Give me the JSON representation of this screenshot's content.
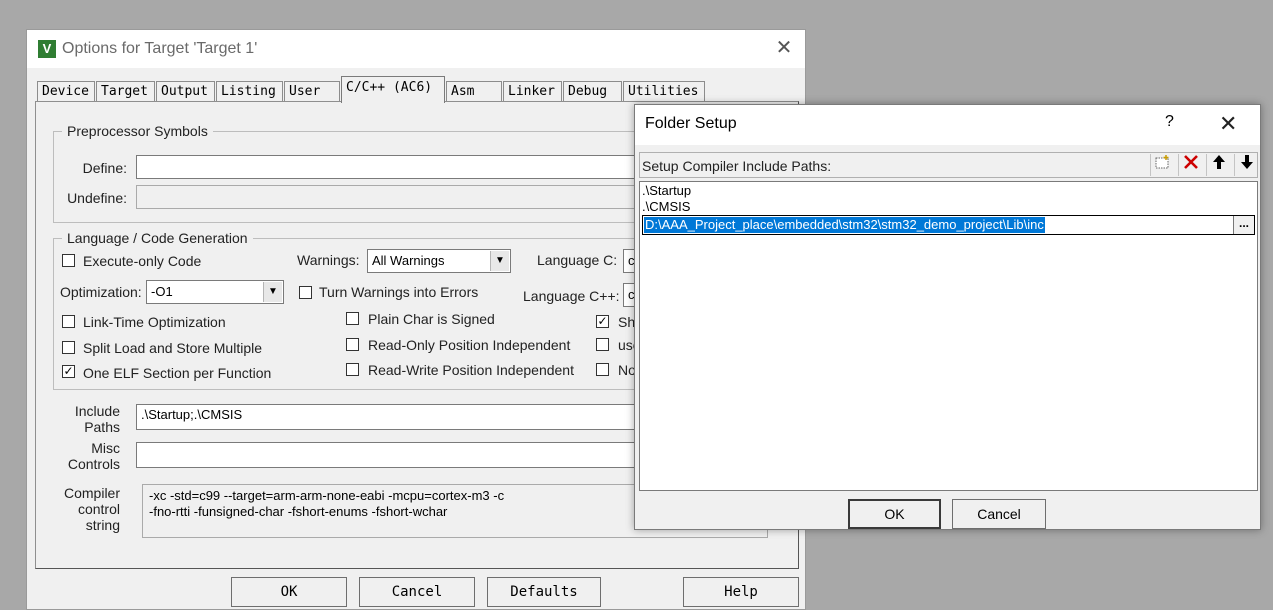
{
  "main_dialog": {
    "title": "Options for Target 'Target 1'",
    "app_icon_letter": "V",
    "close_glyph": "✕",
    "tabs": [
      {
        "label": "Device"
      },
      {
        "label": "Target"
      },
      {
        "label": "Output"
      },
      {
        "label": "Listing"
      },
      {
        "label": "User"
      },
      {
        "label": "C/C++ (AC6)"
      },
      {
        "label": "Asm"
      },
      {
        "label": "Linker"
      },
      {
        "label": "Debug"
      },
      {
        "label": "Utilities"
      }
    ],
    "preprocessor": {
      "legend": "Preprocessor Symbols",
      "define_label": "Define:",
      "define_value": "",
      "undefine_label": "Undefine:",
      "undefine_value": ""
    },
    "codegen": {
      "legend": "Language / Code Generation",
      "execute_only": {
        "label": "Execute-only Code",
        "checked": ""
      },
      "warnings_label": "Warnings:",
      "warnings_value": "All Warnings",
      "language_c_label": "Language C:",
      "language_c_value": "c",
      "optimization_label": "Optimization:",
      "optimization_value": "-O1",
      "turn_warnings": {
        "label": "Turn Warnings into Errors",
        "checked": ""
      },
      "language_cpp_label": "Language C++:",
      "language_cpp_value": "c",
      "lto": {
        "label": "Link-Time Optimization",
        "checked": ""
      },
      "plain_char": {
        "label": "Plain Char is Signed",
        "checked": ""
      },
      "short_opt": {
        "label": "Sh",
        "checked": "✓"
      },
      "split_load": {
        "label": "Split Load and Store Multiple",
        "checked": ""
      },
      "ropi": {
        "label": "Read-Only Position Independent",
        "checked": ""
      },
      "use_opt": {
        "label": "use",
        "checked": ""
      },
      "one_elf": {
        "label": "One ELF Section per Function",
        "checked": "✓"
      },
      "rwpi": {
        "label": "Read-Write Position Independent",
        "checked": ""
      },
      "no_opt": {
        "label": "No",
        "checked": ""
      }
    },
    "include_paths": {
      "label_line1": "Include",
      "label_line2": "Paths",
      "value": ".\\Startup;.\\CMSIS"
    },
    "misc_controls": {
      "label_line1": "Misc",
      "label_line2": "Controls",
      "value": ""
    },
    "compiler_control": {
      "label_line1": "Compiler",
      "label_line2": "control",
      "label_line3": "string",
      "line1": "-xc -std=c99 --target=arm-arm-none-eabi -mcpu=cortex-m3 -c",
      "line2": "-fno-rtti -funsigned-char -fshort-enums -fshort-wchar"
    },
    "buttons": {
      "ok": "OK",
      "cancel": "Cancel",
      "defaults": "Defaults",
      "help": "Help"
    }
  },
  "folder_dialog": {
    "title": "Folder Setup",
    "help_glyph": "?",
    "close_glyph": "✕",
    "header_label": "Setup Compiler Include Paths:",
    "toolbar": {
      "new_icon": "new-folder-icon",
      "delete_icon": "delete-icon",
      "up_icon": "move-up-icon",
      "down_icon": "move-down-icon"
    },
    "paths": [
      ".\\Startup",
      ".\\CMSIS"
    ],
    "editing_path": "D:\\AAA_Project_place\\embedded\\stm32\\stm32_demo_project\\Lib\\inc",
    "browse_label": "...",
    "buttons": {
      "ok": "OK",
      "cancel": "Cancel"
    },
    "accent_color": "#0078d7",
    "delete_color": "#cc0000"
  }
}
